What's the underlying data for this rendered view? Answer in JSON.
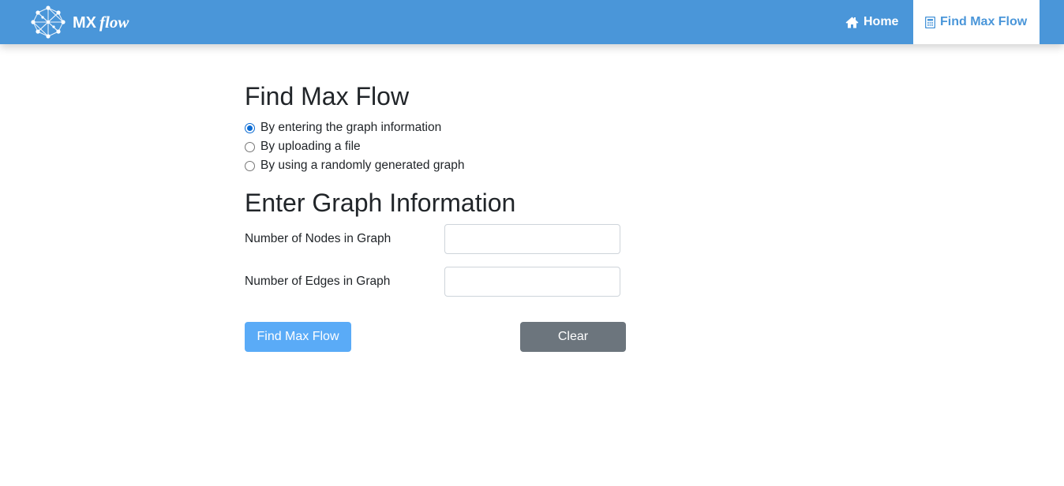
{
  "navbar": {
    "brand_mx": "MX",
    "brand_flow": "flow",
    "home_label": "Home",
    "find_label": "Find Max Flow",
    "home_icon": "home-icon",
    "find_icon": "calculator-icon",
    "bg_color": "#4a96d9"
  },
  "main": {
    "title": "Find Max Flow",
    "options": [
      {
        "label": "By entering the graph information",
        "checked": true
      },
      {
        "label": "By uploading a file",
        "checked": false
      },
      {
        "label": "By using a randomly generated graph",
        "checked": false
      }
    ],
    "subtitle": "Enter Graph Information",
    "nodes_label": "Number of Nodes in Graph",
    "nodes_value": "",
    "edges_label": "Number of Edges in Graph",
    "edges_value": "",
    "submit_label": "Find Max Flow",
    "clear_label": "Clear"
  },
  "colors": {
    "primary_button": "#5aabf7",
    "secondary_button": "#6c757d",
    "radio_selected": "#0b6bd3"
  }
}
